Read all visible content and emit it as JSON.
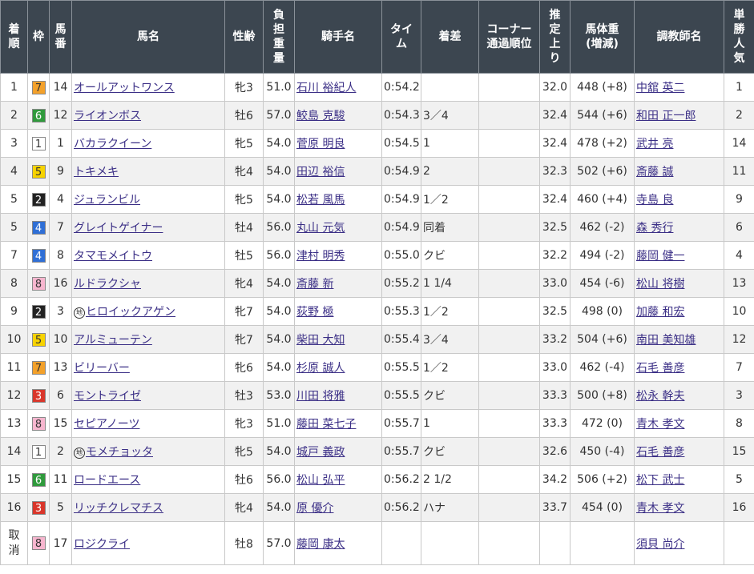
{
  "headers": {
    "rank": "着\n順",
    "waku": "枠",
    "umaban": "馬\n番",
    "horse": "馬名",
    "sexage": "性齢",
    "weight": "負\n担\n重\n量",
    "jockey": "騎手名",
    "time": "タイ\nム",
    "margin": "着差",
    "corner": "コーナー\n通過順位",
    "last3f": "推\n定\n上\nり",
    "body": "馬体重\n(増減)",
    "trainer": "調教師名",
    "pop": "単\n勝\n人\n気"
  },
  "waku_colors": {
    "1": {
      "bg": "#ffffff",
      "fg": "#333333"
    },
    "2": {
      "bg": "#222222",
      "fg": "#ffffff"
    },
    "3": {
      "bg": "#d9362b",
      "fg": "#ffffff"
    },
    "4": {
      "bg": "#2f6fd6",
      "fg": "#ffffff"
    },
    "5": {
      "bg": "#f7d300",
      "fg": "#333333"
    },
    "6": {
      "bg": "#2f9a3c",
      "fg": "#ffffff"
    },
    "7": {
      "bg": "#f3a12b",
      "fg": "#333333"
    },
    "8": {
      "bg": "#f7b6cf",
      "fg": "#333333"
    }
  },
  "local_mark": "地",
  "rows": [
    {
      "rank": "1",
      "waku": "7",
      "umaban": "14",
      "local": false,
      "horse": "オールアットワンス",
      "sexage": "牝3",
      "weight": "51.0",
      "jockey": "石川 裕紀人",
      "time": "0:54.2",
      "margin": "",
      "corner": "",
      "last3f": "32.0",
      "body": "448 (+8)",
      "trainer": "中舘 英二",
      "pop": "1"
    },
    {
      "rank": "2",
      "waku": "6",
      "umaban": "12",
      "local": false,
      "horse": "ライオンボス",
      "sexage": "牡6",
      "weight": "57.0",
      "jockey": "鮫島 克駿",
      "time": "0:54.3",
      "margin": "3／4",
      "corner": "",
      "last3f": "32.4",
      "body": "544 (+6)",
      "trainer": "和田 正一郎",
      "pop": "2"
    },
    {
      "rank": "3",
      "waku": "1",
      "umaban": "1",
      "local": false,
      "horse": "バカラクイーン",
      "sexage": "牝5",
      "weight": "54.0",
      "jockey": "菅原 明良",
      "time": "0:54.5",
      "margin": "1",
      "corner": "",
      "last3f": "32.4",
      "body": "478 (+2)",
      "trainer": "武井 亮",
      "pop": "14"
    },
    {
      "rank": "4",
      "waku": "5",
      "umaban": "9",
      "local": false,
      "horse": "トキメキ",
      "sexage": "牝4",
      "weight": "54.0",
      "jockey": "田辺 裕信",
      "time": "0:54.9",
      "margin": "2",
      "corner": "",
      "last3f": "32.3",
      "body": "502 (+6)",
      "trainer": "斎藤 誠",
      "pop": "11"
    },
    {
      "rank": "5",
      "waku": "2",
      "umaban": "4",
      "local": false,
      "horse": "ジュランビル",
      "sexage": "牝5",
      "weight": "54.0",
      "jockey": "松若 風馬",
      "time": "0:54.9",
      "margin": "1／2",
      "corner": "",
      "last3f": "32.4",
      "body": "460 (+4)",
      "trainer": "寺島 良",
      "pop": "9"
    },
    {
      "rank": "5",
      "waku": "4",
      "umaban": "7",
      "local": false,
      "horse": "グレイトゲイナー",
      "sexage": "牡4",
      "weight": "56.0",
      "jockey": "丸山 元気",
      "time": "0:54.9",
      "margin": "同着",
      "corner": "",
      "last3f": "32.5",
      "body": "462 (-2)",
      "trainer": "森 秀行",
      "pop": "6"
    },
    {
      "rank": "7",
      "waku": "4",
      "umaban": "8",
      "local": false,
      "horse": "タマモメイトウ",
      "sexage": "牡5",
      "weight": "56.0",
      "jockey": "津村 明秀",
      "time": "0:55.0",
      "margin": "クビ",
      "corner": "",
      "last3f": "32.2",
      "body": "494 (-2)",
      "trainer": "藤岡 健一",
      "pop": "4"
    },
    {
      "rank": "8",
      "waku": "8",
      "umaban": "16",
      "local": false,
      "horse": "ルドラクシャ",
      "sexage": "牝4",
      "weight": "54.0",
      "jockey": "斎藤 新",
      "time": "0:55.2",
      "margin": "1 1/4",
      "corner": "",
      "last3f": "33.0",
      "body": "454 (-6)",
      "trainer": "松山 将樹",
      "pop": "13"
    },
    {
      "rank": "9",
      "waku": "2",
      "umaban": "3",
      "local": true,
      "horse": "ヒロイックアゲン",
      "sexage": "牝7",
      "weight": "54.0",
      "jockey": "荻野 極",
      "time": "0:55.3",
      "margin": "1／2",
      "corner": "",
      "last3f": "32.5",
      "body": "498 (0)",
      "trainer": "加藤 和宏",
      "pop": "10"
    },
    {
      "rank": "10",
      "waku": "5",
      "umaban": "10",
      "local": false,
      "horse": "アルミューテン",
      "sexage": "牝7",
      "weight": "54.0",
      "jockey": "柴田 大知",
      "time": "0:55.4",
      "margin": "3／4",
      "corner": "",
      "last3f": "33.2",
      "body": "504 (+6)",
      "trainer": "南田 美知雄",
      "pop": "12"
    },
    {
      "rank": "11",
      "waku": "7",
      "umaban": "13",
      "local": false,
      "horse": "ビリーバー",
      "sexage": "牝6",
      "weight": "54.0",
      "jockey": "杉原 誠人",
      "time": "0:55.5",
      "margin": "1／2",
      "corner": "",
      "last3f": "33.0",
      "body": "462 (-4)",
      "trainer": "石毛 善彦",
      "pop": "7"
    },
    {
      "rank": "12",
      "waku": "3",
      "umaban": "6",
      "local": false,
      "horse": "モントライゼ",
      "sexage": "牡3",
      "weight": "53.0",
      "jockey": "川田 将雅",
      "time": "0:55.5",
      "margin": "クビ",
      "corner": "",
      "last3f": "33.3",
      "body": "500 (+8)",
      "trainer": "松永 幹夫",
      "pop": "3"
    },
    {
      "rank": "13",
      "waku": "8",
      "umaban": "15",
      "local": false,
      "horse": "セピアノーツ",
      "sexage": "牝3",
      "weight": "51.0",
      "jockey": "藤田 菜七子",
      "time": "0:55.7",
      "margin": "1",
      "corner": "",
      "last3f": "33.3",
      "body": "472 (0)",
      "trainer": "青木 孝文",
      "pop": "8"
    },
    {
      "rank": "14",
      "waku": "1",
      "umaban": "2",
      "local": true,
      "horse": "モメチョッタ",
      "sexage": "牝5",
      "weight": "54.0",
      "jockey": "城戸 義政",
      "time": "0:55.7",
      "margin": "クビ",
      "corner": "",
      "last3f": "32.6",
      "body": "450 (-4)",
      "trainer": "石毛 善彦",
      "pop": "15"
    },
    {
      "rank": "15",
      "waku": "6",
      "umaban": "11",
      "local": false,
      "horse": "ロードエース",
      "sexage": "牡6",
      "weight": "56.0",
      "jockey": "松山 弘平",
      "time": "0:56.2",
      "margin": "2 1/2",
      "corner": "",
      "last3f": "34.2",
      "body": "506 (+2)",
      "trainer": "松下 武士",
      "pop": "5"
    },
    {
      "rank": "16",
      "waku": "3",
      "umaban": "5",
      "local": false,
      "horse": "リッチクレマチス",
      "sexage": "牝4",
      "weight": "54.0",
      "jockey": "原 優介",
      "time": "0:56.2",
      "margin": "ハナ",
      "corner": "",
      "last3f": "33.7",
      "body": "454 (0)",
      "trainer": "青木 孝文",
      "pop": "16"
    },
    {
      "rank": "取\n消",
      "waku": "8",
      "umaban": "17",
      "local": false,
      "horse": "ロジクライ",
      "sexage": "牡8",
      "weight": "57.0",
      "jockey": "藤岡 康太",
      "time": "",
      "margin": "",
      "corner": "",
      "last3f": "",
      "body": "",
      "trainer": "須貝 尚介",
      "pop": ""
    }
  ]
}
